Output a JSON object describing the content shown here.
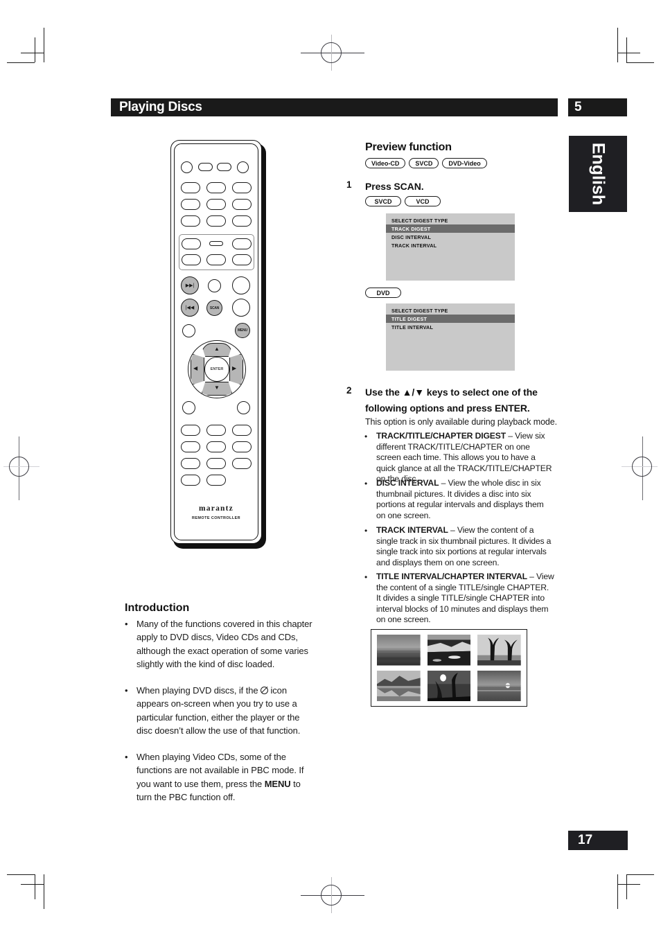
{
  "header": {
    "title": "Playing Discs",
    "chapter": "5",
    "language_tab": "English",
    "page_number": "17"
  },
  "remote": {
    "brand": "marantz",
    "brand_sub": "REMOTE CONTROLLER",
    "buttons": {
      "next": "▶▶|",
      "prev": "|◀◀",
      "scan": "SCAN",
      "menu": "MENU",
      "enter": "ENTER",
      "up": "▲",
      "down": "▼",
      "left": "◀",
      "right": "▶"
    }
  },
  "preview": {
    "title": "Preview function",
    "disc_badges": [
      "Video-CD",
      "SVCD",
      "DVD-Video"
    ],
    "step1": {
      "number": "1",
      "title": "Press SCAN.",
      "badges": [
        "SVCD",
        "VCD"
      ],
      "osd_vcd": {
        "header": "SELECT DIGEST TYPE",
        "rows": [
          {
            "label": "TRACK DIGEST",
            "selected": true
          },
          {
            "label": "DISC INTERVAL",
            "selected": false
          },
          {
            "label": "TRACK INTERVAL",
            "selected": false
          }
        ]
      },
      "dvd_badge": "DVD",
      "osd_dvd": {
        "header": "SELECT DIGEST TYPE",
        "rows": [
          {
            "label": "TITLE DIGEST",
            "selected": true
          },
          {
            "label": "TITLE INTERVAL",
            "selected": false
          }
        ]
      }
    },
    "step2": {
      "number": "2",
      "title_line1": "Use the ▲/▼ keys to select one of the",
      "title_line2": "following options and press ENTER.",
      "note": "This option is only available during playback mode.",
      "options": [
        {
          "term": "TRACK/TITLE/CHAPTER DIGEST",
          "desc": "– View six different TRACK/TITLE/CHAPTER on one screen each time. This allows you to have a quick glance at all the TRACK/TITLE/CHAPTER on the disc."
        },
        {
          "term": "DISC INTERVAL",
          "desc": "– View the whole disc in six thumbnail pictures. It divides a disc into six portions at regular intervals and displays them on one screen."
        },
        {
          "term": "TRACK INTERVAL",
          "desc": "– View the content of a single track in six thumbnail pictures. It divides a single track into six portions at regular intervals and displays them on one screen."
        },
        {
          "term": "TITLE INTERVAL/CHAPTER INTERVAL",
          "desc": "– View the content of a single TITLE/single CHAPTER. It divides a single TITLE/single CHAPTER into interval blocks of 10 minutes and displays them on one screen."
        }
      ]
    }
  },
  "introduction": {
    "title": "Introduction",
    "bullets": [
      "Many of the functions covered in this chapter apply to DVD discs, Video CDs and CDs, although the exact operation of some varies slightly with the kind of disc loaded.",
      "When playing DVD discs, if the ⓧ icon appears on-screen when you try to use a particular function, either the player or the disc doesn’t allow the use of that function.",
      "When playing Video CDs, some of the functions are not available in PBC mode. If you want to use them, press the MENU to turn the PBC function off."
    ]
  }
}
